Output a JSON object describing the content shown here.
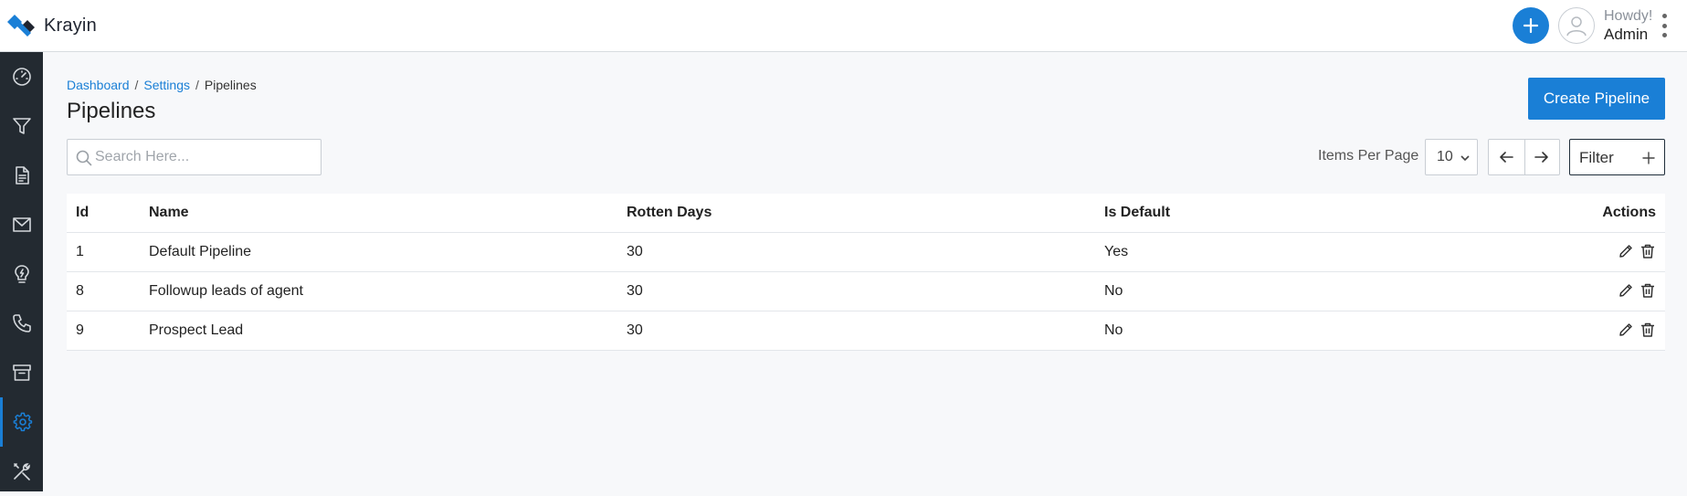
{
  "app": {
    "brand": "Krayin",
    "brand_color": "#1a7fd6",
    "sidebar_color": "#232a31"
  },
  "header": {
    "greeting": "Howdy!",
    "username": "Admin"
  },
  "sidebar": {
    "items": [
      {
        "name": "dashboard",
        "icon": "speedometer-icon",
        "active": false
      },
      {
        "name": "leads",
        "icon": "filter-funnel-icon",
        "active": false
      },
      {
        "name": "quotes",
        "icon": "document-icon",
        "active": false
      },
      {
        "name": "mail",
        "icon": "mail-icon",
        "active": false
      },
      {
        "name": "activities",
        "icon": "lightbulb-icon",
        "active": false
      },
      {
        "name": "contacts",
        "icon": "phone-icon",
        "active": false
      },
      {
        "name": "products",
        "icon": "archive-box-icon",
        "active": false
      },
      {
        "name": "settings",
        "icon": "gear-icon",
        "active": true
      },
      {
        "name": "configuration",
        "icon": "tools-icon",
        "active": false
      }
    ]
  },
  "breadcrumb": {
    "items": [
      "Dashboard",
      "Settings",
      "Pipelines"
    ],
    "separator": "/"
  },
  "page": {
    "title": "Pipelines",
    "create_label": "Create Pipeline"
  },
  "toolbar": {
    "search_placeholder": "Search Here...",
    "items_per_page_label": "Items Per Page",
    "items_per_page_value": "10",
    "filter_label": "Filter"
  },
  "table": {
    "headers": [
      "Id",
      "Name",
      "Rotten Days",
      "Is Default",
      "Actions"
    ],
    "rows": [
      {
        "id": "1",
        "name": "Default Pipeline",
        "rotten_days": "30",
        "is_default": "Yes"
      },
      {
        "id": "8",
        "name": "Followup leads of agent",
        "rotten_days": "30",
        "is_default": "No"
      },
      {
        "id": "9",
        "name": "Prospect Lead",
        "rotten_days": "30",
        "is_default": "No"
      }
    ]
  }
}
